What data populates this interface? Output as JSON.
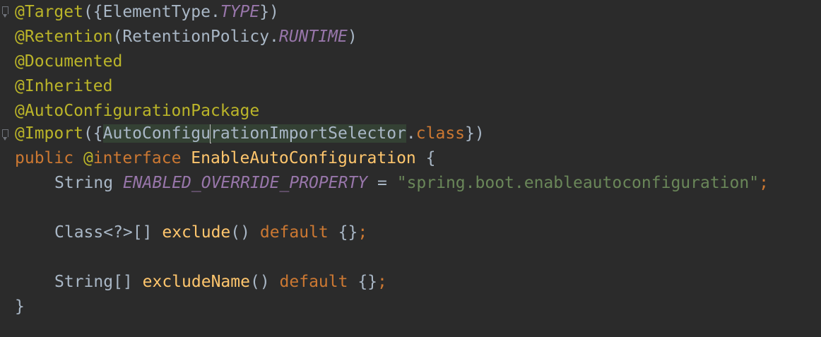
{
  "editor": {
    "background": "#2b2b2b",
    "colors": {
      "annotation": "#bbb529",
      "keyword": "#cc7832",
      "constant": "#9876aa",
      "function": "#ffc66d",
      "string": "#6a8759",
      "plain": "#a9b7c6"
    },
    "gutter": {
      "fold_icons": [
        "fold-marker-icon",
        "fold-marker-icon"
      ]
    },
    "lines": {
      "l1": {
        "ann": "@Target",
        "p1": "({ElementType.",
        "const": "TYPE",
        "p2": "})"
      },
      "l2": {
        "ann": "@Retention",
        "p1": "(RetentionPolicy.",
        "const": "RUNTIME",
        "p2": ")"
      },
      "l3": {
        "ann": "@Documented"
      },
      "l4": {
        "ann": "@Inherited"
      },
      "l5": {
        "ann": "@AutoConfigurationPackage"
      },
      "l6": {
        "ann": "@Import",
        "p1": "({",
        "sel_a": "AutoConfigu",
        "sel_b": "rationImportSelector",
        "p2": ".",
        "kw": "class",
        "p3": "})"
      },
      "l7": {
        "kw1": "public",
        "ann": "@",
        "kw2": "interface",
        "name": "EnableAutoConfiguration",
        "p1": "{"
      },
      "l8": {
        "type": "String",
        "const": "ENABLED_OVERRIDE_PROPERTY",
        "eq": "=",
        "str": "\"spring.boot.enableautoconfiguration\"",
        "semi": ";"
      },
      "l10": {
        "type": "Class<?>[]",
        "fn": "exclude",
        "parens": "()",
        "kw": "default",
        "braces": "{}",
        "semi": ";"
      },
      "l12": {
        "type": "String[]",
        "fn": "excludeName",
        "parens": "()",
        "kw": "default",
        "braces": "{}",
        "semi": ";"
      },
      "l13": {
        "p1": "}"
      }
    }
  }
}
